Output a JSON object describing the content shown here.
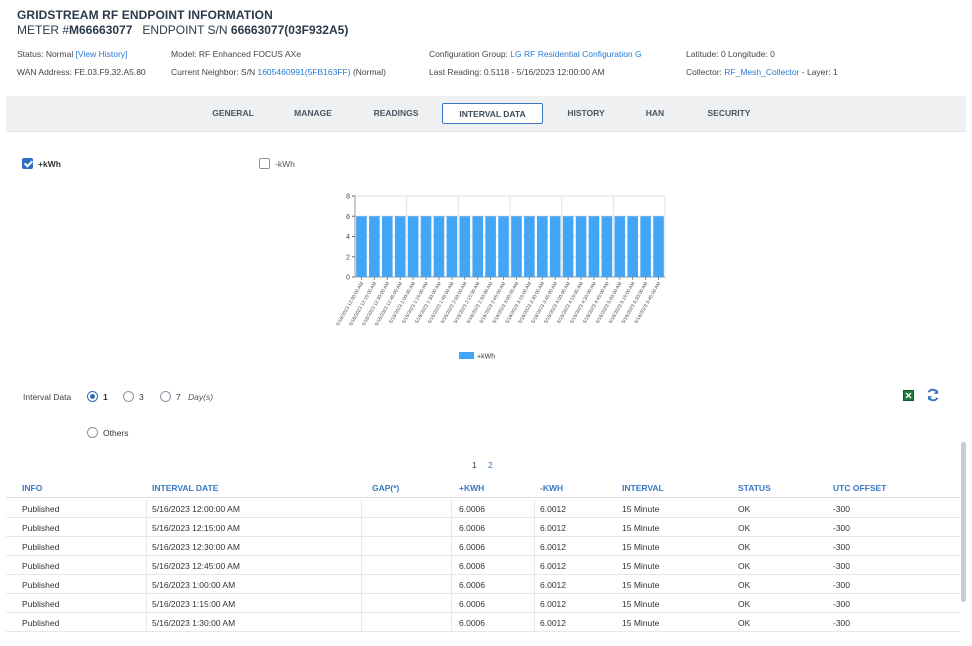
{
  "header": {
    "title": "GRIDSTREAM RF ENDPOINT INFORMATION",
    "meter_prefix": "METER #",
    "meter_number": "M66663077",
    "endpoint_prefix": "ENDPOINT S/N",
    "endpoint_sn": "66663077(03F932A5)"
  },
  "info": {
    "status_label": "Status: Normal",
    "view_history": "[View History]",
    "wan": "WAN Address: FE.03.F9.32.A5.80",
    "model": "Model: RF Enhanced FOCUS AXe",
    "neighbor_label": "Current Neighbor: S/N",
    "neighbor_link": "1605460991(5FB163FF)",
    "neighbor_status": "(Normal)",
    "config_label": "Configuration Group:",
    "config_link": "LG RF Residential Configuration G",
    "last_reading": "Last Reading: 0.5118 - 5/16/2023 12:00:00 AM",
    "latlon": "Latitude: 0  Longitude: 0",
    "collector_label": "Collector:",
    "collector_link": "RF_Mesh_Collector",
    "layer": "- Layer: 1"
  },
  "tabs": [
    "GENERAL",
    "MANAGE",
    "READINGS",
    "INTERVAL DATA",
    "HISTORY",
    "HAN",
    "SECURITY"
  ],
  "active_tab": "INTERVAL DATA",
  "filters": {
    "plus_kwh": "+kWh",
    "minus_kwh": "-kWh",
    "plus_checked": true,
    "minus_checked": false
  },
  "interval_controls": {
    "label": "Interval Data",
    "opt1": "1",
    "opt3": "3",
    "opt7": "7",
    "days": "Day(s)",
    "others": "Others",
    "selected": "1"
  },
  "icons": {
    "excel": "excel-export-icon",
    "refresh": "refresh-icon"
  },
  "colors": {
    "accent": "#2a7ad6",
    "bar": "#42a5f5"
  },
  "chart_data": {
    "type": "bar",
    "categories": [
      "5/16/2023 12:00:00 AM",
      "5/16/2023 12:15:00 AM",
      "5/16/2023 12:30:00 AM",
      "5/16/2023 12:45:00 AM",
      "5/16/2023 1:00:00 AM",
      "5/16/2023 1:15:00 AM",
      "5/16/2023 1:30:00 AM",
      "5/16/2023 1:45:00 AM",
      "5/16/2023 2:00:00 AM",
      "5/16/2023 2:15:00 AM",
      "5/16/2023 2:30:00 AM",
      "5/16/2023 2:45:00 AM",
      "5/16/2023 3:00:00 AM",
      "5/16/2023 3:15:00 AM",
      "5/16/2023 3:30:00 AM",
      "5/16/2023 3:45:00 AM",
      "5/16/2023 4:00:00 AM",
      "5/16/2023 4:15:00 AM",
      "5/16/2023 4:30:00 AM",
      "5/16/2023 4:45:00 AM",
      "5/16/2023 5:00:00 AM",
      "5/16/2023 5:15:00 AM",
      "5/16/2023 5:30:00 AM",
      "5/16/2023 5:45:00 AM"
    ],
    "series": [
      {
        "name": "+kWh",
        "values": [
          6.0006,
          6.0006,
          6.0006,
          6.0006,
          6.0006,
          6.0006,
          6.0006,
          6.0006,
          6.0006,
          6.0006,
          6.0006,
          6.0006,
          6.0006,
          6.0006,
          6.0006,
          6.0006,
          6.0006,
          6.0006,
          6.0006,
          6.0006,
          6.0006,
          6.0006,
          6.0006,
          6.0006
        ]
      }
    ],
    "yticks": [
      0,
      2,
      4,
      6,
      8
    ],
    "ylim": [
      0,
      8
    ],
    "grid": true,
    "legend": "bottom"
  },
  "pager": {
    "page1": "1",
    "page2": "2"
  },
  "table": {
    "columns": [
      "INFO",
      "INTERVAL DATE",
      "GAP(*)",
      "+KWH",
      "-KWH",
      "INTERVAL",
      "STATUS",
      "UTC OFFSET"
    ],
    "rows": [
      [
        "Published",
        "5/16/2023 12:00:00 AM",
        "",
        "6.0006",
        "6.0012",
        "15 Minute",
        "OK",
        "-300"
      ],
      [
        "Published",
        "5/16/2023 12:15:00 AM",
        "",
        "6.0006",
        "6.0012",
        "15 Minute",
        "OK",
        "-300"
      ],
      [
        "Published",
        "5/16/2023 12:30:00 AM",
        "",
        "6.0006",
        "6.0012",
        "15 Minute",
        "OK",
        "-300"
      ],
      [
        "Published",
        "5/16/2023 12:45:00 AM",
        "",
        "6.0006",
        "6.0012",
        "15 Minute",
        "OK",
        "-300"
      ],
      [
        "Published",
        "5/16/2023 1:00:00 AM",
        "",
        "6.0006",
        "6.0012",
        "15 Minute",
        "OK",
        "-300"
      ],
      [
        "Published",
        "5/16/2023 1:15:00 AM",
        "",
        "6.0006",
        "6.0012",
        "15 Minute",
        "OK",
        "-300"
      ],
      [
        "Published",
        "5/16/2023 1:30:00 AM",
        "",
        "6.0006",
        "6.0012",
        "15 Minute",
        "OK",
        "-300"
      ]
    ]
  }
}
